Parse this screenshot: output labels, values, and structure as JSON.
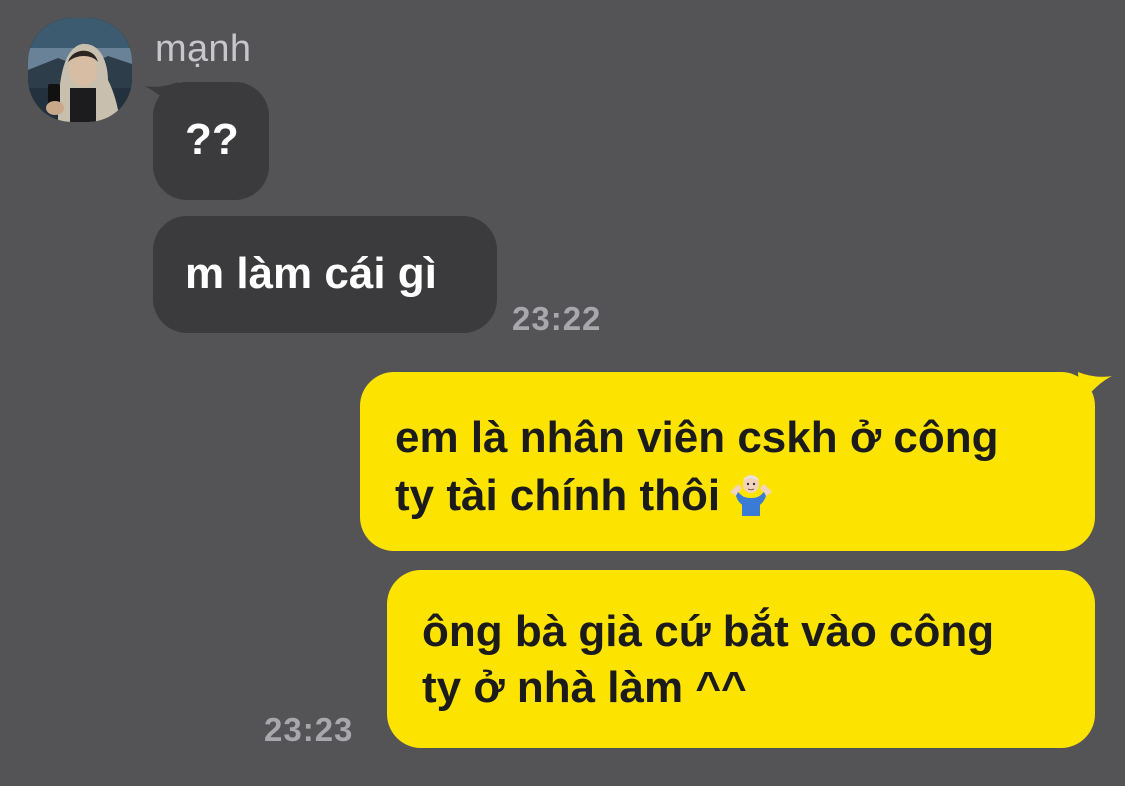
{
  "contact": {
    "name": "mạnh",
    "avatar_icon": "profile-photo"
  },
  "messages": [
    {
      "direction": "incoming",
      "text": "??"
    },
    {
      "direction": "incoming",
      "text": "m làm cái gì",
      "time": "23:22"
    },
    {
      "direction": "outgoing",
      "lines": [
        "em là nhân viên cskh ở công",
        "ty tài chính thôi"
      ],
      "emoji": "person-shrugging-icon"
    },
    {
      "direction": "outgoing",
      "lines": [
        "ông bà già cứ bắt vào công",
        "ty ở nhà làm ^^"
      ],
      "time": "23:23"
    }
  ],
  "colors": {
    "background": "#545356",
    "incoming_bubble": "#3b3a3d",
    "outgoing_bubble": "#fde400",
    "timestamp": "#a8a7ab"
  }
}
